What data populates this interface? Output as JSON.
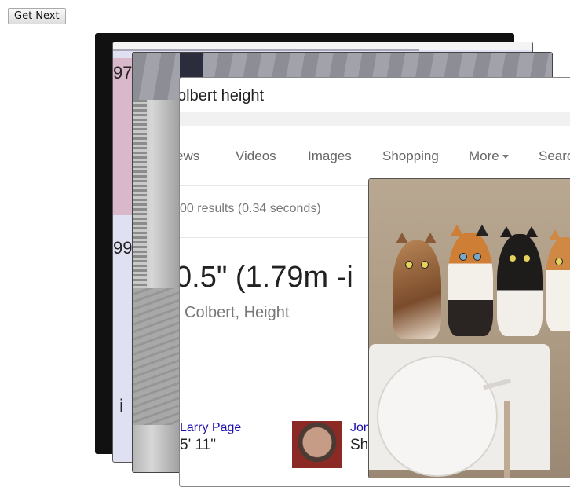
{
  "toolbar": {
    "get_next_label": "Get Next"
  },
  "card_numbers": {
    "num1": "97",
    "num2": "99",
    "letter": "i"
  },
  "search": {
    "query": "olbert height",
    "tabs": [
      "ews",
      "Videos",
      "Images",
      "Shopping",
      "More",
      "Searc"
    ],
    "result_stats": "00 results (0.34 seconds)",
    "answer": "0.5\" (1.79m -i",
    "answer_sub": "Colbert, Height",
    "people": [
      {
        "name": "Larry Page",
        "height": "5' 11\""
      },
      {
        "name": "Jon",
        "height": "Sh"
      }
    ]
  },
  "colors": {
    "link": "#1a0dab",
    "muted_text": "#777777",
    "card_border": "#444444"
  }
}
